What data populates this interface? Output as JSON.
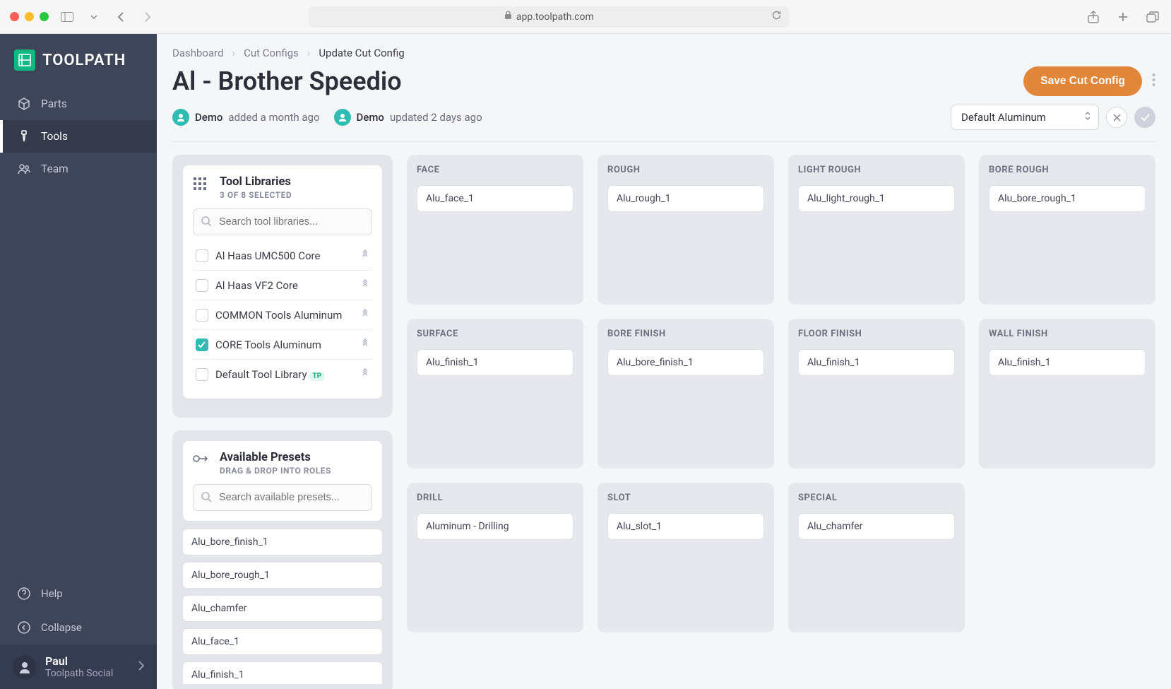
{
  "browser": {
    "url": "app.toolpath.com"
  },
  "brand": "TOOLPATH",
  "nav": {
    "parts": "Parts",
    "tools": "Tools",
    "team": "Team",
    "help": "Help",
    "collapse": "Collapse"
  },
  "user": {
    "name": "Paul",
    "org": "Toolpath Social"
  },
  "breadcrumb": {
    "a": "Dashboard",
    "b": "Cut Configs",
    "c": "Update Cut Config"
  },
  "page_title": "Al - Brother Speedio",
  "save_label": "Save Cut Config",
  "meta": {
    "created_by": "Demo",
    "created_text": "added a month ago",
    "updated_by": "Demo",
    "updated_text": "updated 2 days ago"
  },
  "material_select": "Default Aluminum",
  "tool_libraries": {
    "title": "Tool Libraries",
    "subtitle": "3 OF 8 SELECTED",
    "search_placeholder": "Search tool libraries...",
    "items": [
      {
        "label": "Al Haas UMC500 Core",
        "checked": false
      },
      {
        "label": "Al Haas VF2 Core",
        "checked": false
      },
      {
        "label": "COMMON Tools Aluminum",
        "checked": false
      },
      {
        "label": "CORE Tools Aluminum",
        "checked": true
      },
      {
        "label": "Default Tool Library",
        "checked": false,
        "badge": true
      }
    ]
  },
  "available_presets": {
    "title": "Available Presets",
    "subtitle": "DRAG & DROP INTO ROLES",
    "search_placeholder": "Search available presets...",
    "items": [
      "Alu_bore_finish_1",
      "Alu_bore_rough_1",
      "Alu_chamfer",
      "Alu_face_1",
      "Alu_finish_1"
    ]
  },
  "roles": [
    {
      "title": "FACE",
      "preset": "Alu_face_1"
    },
    {
      "title": "ROUGH",
      "preset": "Alu_rough_1"
    },
    {
      "title": "LIGHT ROUGH",
      "preset": "Alu_light_rough_1"
    },
    {
      "title": "BORE ROUGH",
      "preset": "Alu_bore_rough_1"
    },
    {
      "title": "SURFACE",
      "preset": "Alu_finish_1"
    },
    {
      "title": "BORE FINISH",
      "preset": "Alu_bore_finish_1"
    },
    {
      "title": "FLOOR FINISH",
      "preset": "Alu_finish_1"
    },
    {
      "title": "WALL FINISH",
      "preset": "Alu_finish_1"
    },
    {
      "title": "DRILL",
      "preset": "Aluminum - Drilling"
    },
    {
      "title": "SLOT",
      "preset": "Alu_slot_1"
    },
    {
      "title": "SPECIAL",
      "preset": "Alu_chamfer"
    }
  ]
}
